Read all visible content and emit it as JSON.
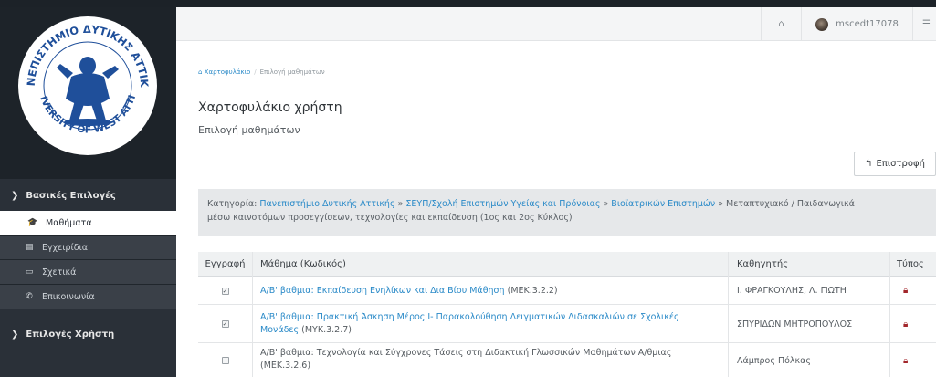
{
  "topbar": {
    "home_icon": "home-icon",
    "username": "mscedt17078",
    "settings_icon": "sliders-icon"
  },
  "sidebar": {
    "logo_text_top": "ΠΑΝΕΠΙΣΤΗΜΙΟ ΔΥΤΙΚΗΣ ΑΤΤΙΚΗΣ",
    "logo_text_bottom": "UNIVERSITY OF WEST ATTICA",
    "section_basic": "Βασικές Επιλογές",
    "items": [
      {
        "label": "Μαθήματα",
        "icon": "graduation-cap-icon",
        "active": true
      },
      {
        "label": "Εγχειρίδια",
        "icon": "document-icon",
        "active": false
      },
      {
        "label": "Σχετικά",
        "icon": "card-icon",
        "active": false
      },
      {
        "label": "Επικοινωνία",
        "icon": "phone-icon",
        "active": false
      }
    ],
    "section_user": "Επιλογές Χρήστη"
  },
  "breadcrumb": {
    "home": "Χαρτοφυλάκιο",
    "current": "Επιλογή μαθημάτων"
  },
  "page": {
    "title": "Χαρτοφυλάκιο χρήστη",
    "subtitle": "Επιλογή μαθημάτων",
    "back_label": "Επιστροφή"
  },
  "category": {
    "prefix": "Κατηγορία: ",
    "link1": "Πανεπιστήμιο Δυτικής Αττικής",
    "sep": " » ",
    "link2": "ΣΕΥΠ/Σχολή Επιστημών Υγείας και Πρόνοιας",
    "link3": "Βιοϊατρικών Επιστημών",
    "tail1": " » Μεταπτυχιακό / Παιδαγωγικά",
    "tail2": "μέσω καινοτόμων προσεγγίσεων, τεχνολογίες και εκπαίδευση (1ος και 2ος Κύκλος)"
  },
  "table": {
    "headers": {
      "enroll": "Εγγραφή",
      "course": "Μάθημα (Κωδικός)",
      "teacher": "Καθηγητής",
      "type": "Τύπος"
    },
    "rows": [
      {
        "checked": true,
        "course_line1": "Α/Β' βαθμια: Εκπαίδευση Ενηλίκων και Δια Βίου Μάθηση",
        "course_line2": "",
        "code": "(ΜΕΚ.3.2.2)",
        "linked": true,
        "teacher": "Ι. ΦΡΑΓΚΟΥΛΗΣ, Λ. ΓΙΩΤΗ"
      },
      {
        "checked": true,
        "course_line1": "Α/Β' βαθμια: Πρακτική Άσκηση Μέρος Ι- Παρακολούθηση Δειγματικών Διδασκαλιών σε Σχολικές",
        "course_line2": "Μονάδες",
        "code": "(ΜΥΚ.3.2.7)",
        "linked": true,
        "teacher": "ΣΠΥΡΙΔΩΝ ΜΗΤΡΟΠΟΥΛΟΣ"
      },
      {
        "checked": false,
        "course_line1": "Α/Β' βαθμια: Τεχνολογία και Σύγχρονες Τάσεις στη Διδακτική Γλωσσικών Μαθημάτων Α/θμιας",
        "course_line2": "",
        "code": "(ΜΕΚ.3.2.6)",
        "linked": false,
        "teacher": "Λάμπρος Πόλκας"
      }
    ]
  },
  "colors": {
    "link": "#2a8ac8",
    "sidebar_bg": "#2a3038",
    "lock": "#a2262b"
  }
}
